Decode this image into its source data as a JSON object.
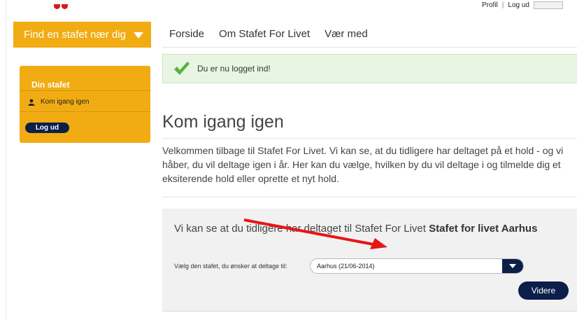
{
  "top_links": {
    "profile": "Profil",
    "separator": "|",
    "logout": "Log ud"
  },
  "find_bar": {
    "label": "Find en stafet nær dig"
  },
  "nav": {
    "items": [
      "Forside",
      "Om Stafet For Livet",
      "Vær med"
    ]
  },
  "sidebar": {
    "title": "Din stafet",
    "item": "Kom igang igen",
    "logout_button": "Log ud"
  },
  "alert": {
    "message": "Du er nu logget ind!"
  },
  "main": {
    "heading": "Kom igang igen",
    "intro": "Velkommen tilbage til Stafet For Livet. Vi kan se, at du tidligere har deltaget på et hold - og vi håber, du vil deltage igen i år. Her kan du vælge, hvilken by du vil deltage i og tilmelde dig et eksiterende hold eller oprette et nyt hold."
  },
  "panel": {
    "text_prefix": "Vi kan se at du tidligere har deltaget til Stafet For Livet ",
    "text_bold": "Stafet for livet Aarhus",
    "select_label": "Vælg den stafet, du ønsker at deltage til:",
    "select_value": "Aarhus (21/06-2014)",
    "button": "Videre"
  },
  "colors": {
    "brand_orange": "#f0ac12",
    "navy": "#0c1f4a",
    "success_bg": "#e9f5e3",
    "check_green": "#57b43a",
    "annotation_red": "#e81515"
  },
  "icons": {
    "alert": "checkmark-icon",
    "sidebar_item": "person-icon",
    "dropdown": "chevron-down-icon",
    "annotation": "arrow-icon"
  }
}
